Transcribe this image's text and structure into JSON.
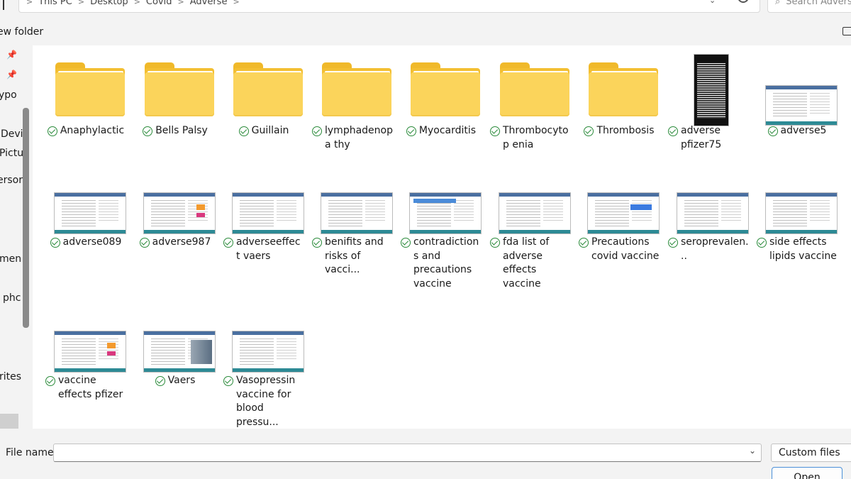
{
  "address": {
    "segments": [
      "This PC",
      "Desktop",
      "Covid",
      "Adverse"
    ],
    "separator": ">"
  },
  "search": {
    "placeholder": "Search Adverse"
  },
  "toolbar": {
    "new_folder_label": "ew folder"
  },
  "nav": {
    "items": [
      "ypo",
      "Devi",
      "Pictu",
      "ersor",
      "men",
      "phc",
      "rites"
    ]
  },
  "files": [
    {
      "name": "Anaphylactic",
      "kind": "folder"
    },
    {
      "name": "Bells Palsy",
      "kind": "folder"
    },
    {
      "name": "Guillain",
      "kind": "folder"
    },
    {
      "name": "lymphadenopa thy",
      "kind": "folder"
    },
    {
      "name": "Myocarditis",
      "kind": "folder"
    },
    {
      "name": "Thrombocytop enia",
      "kind": "folder"
    },
    {
      "name": "Thrombosis",
      "kind": "folder"
    },
    {
      "name": "adverse pfizer75",
      "kind": "portrait"
    },
    {
      "name": "adverse5",
      "kind": "image"
    },
    {
      "name": "adverse089",
      "kind": "image"
    },
    {
      "name": "adverse987",
      "kind": "image"
    },
    {
      "name": "adverseeffect vaers",
      "kind": "image"
    },
    {
      "name": "benifits and risks of vacci...",
      "kind": "image"
    },
    {
      "name": "contradictions and precautions vaccine",
      "kind": "image"
    },
    {
      "name": "fda list of adverse effects vaccine",
      "kind": "image"
    },
    {
      "name": "Precautions covid vaccine",
      "kind": "image"
    },
    {
      "name": "seroprevalen...",
      "kind": "image"
    },
    {
      "name": "side effects lipids vaccine",
      "kind": "image"
    },
    {
      "name": "vaccine effects pfizer",
      "kind": "image"
    },
    {
      "name": "Vaers",
      "kind": "image"
    },
    {
      "name": "Vasopressin vaccine for blood pressu...",
      "kind": "image"
    }
  ],
  "bottom": {
    "file_name_label": "File name:",
    "file_name_value": "",
    "filter_label": "Custom files",
    "open_label": "Open"
  }
}
